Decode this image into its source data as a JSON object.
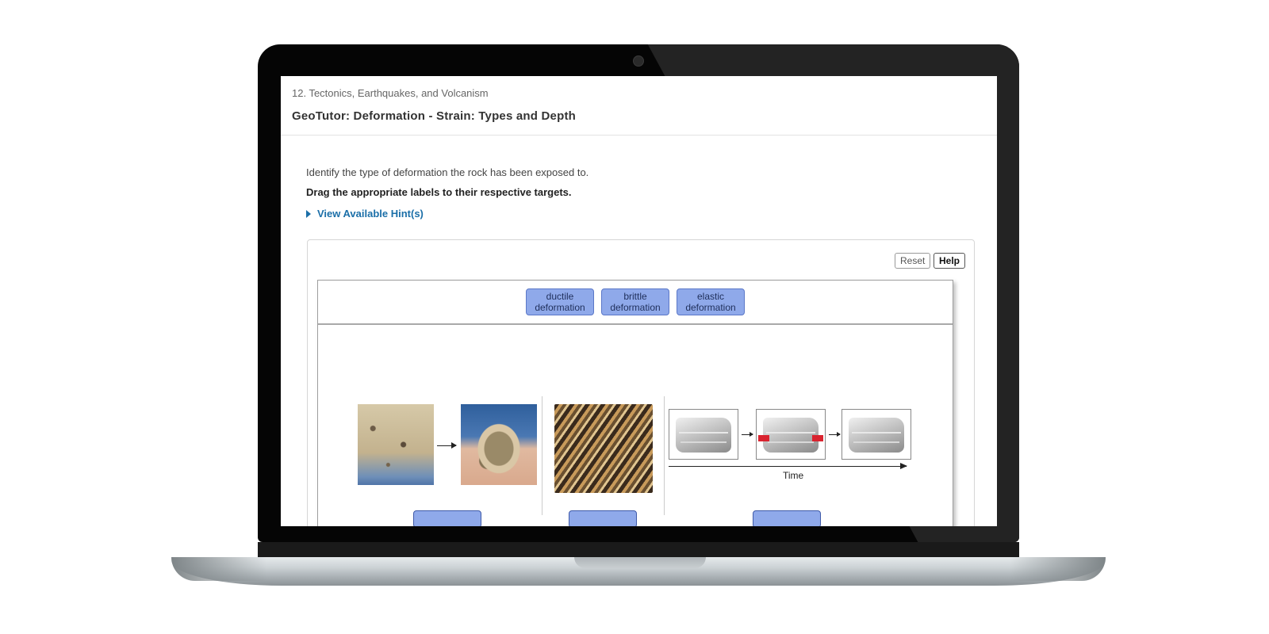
{
  "breadcrumb": "12. Tectonics, Earthquakes, and Volcanism",
  "title": "GeoTutor: Deformation - Strain: Types and Depth",
  "prompt": "Identify the type of deformation the rock has been exposed to.",
  "instruction": "Drag the appropriate labels to their respective targets.",
  "hint_link": "View Available Hint(s)",
  "buttons": {
    "reset": "Reset",
    "help": "Help"
  },
  "labels": [
    {
      "line1": "ductile",
      "line2": "deformation"
    },
    {
      "line1": "brittle",
      "line2": "deformation"
    },
    {
      "line1": "elastic",
      "line2": "deformation"
    }
  ],
  "diagram": {
    "time_label": "Time"
  },
  "colors": {
    "label_fill": "#8fa9ea",
    "link": "#1b6fa8",
    "stress_arrow": "#d9232f"
  }
}
